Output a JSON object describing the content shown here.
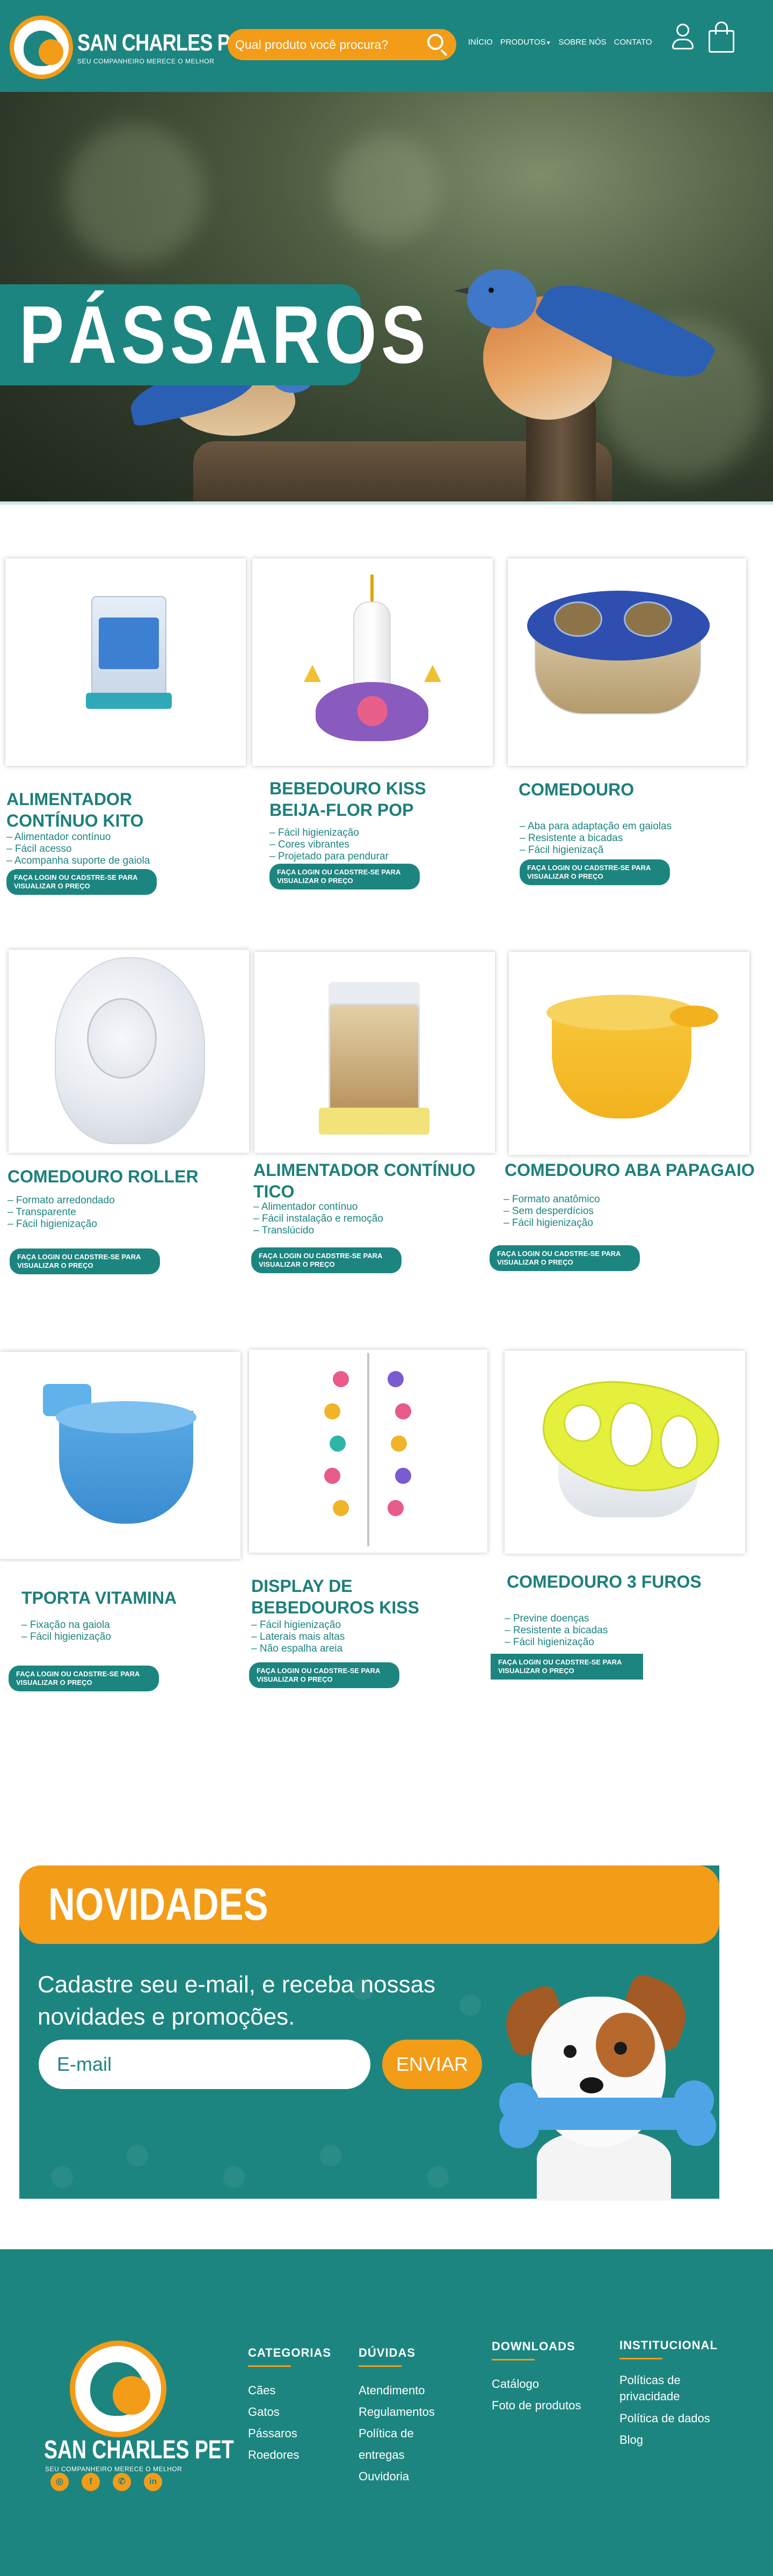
{
  "header": {
    "logo_name": "SAN CHARLES PET",
    "logo_tagline": "SEU COMPANHEIRO MERECE O MELHOR",
    "search_placeholder": "Qual produto você procura?",
    "nav": [
      "INÍCIO",
      "PRODUTOS",
      "SOBRE NÓS",
      "CONTATO"
    ],
    "icons": [
      "search-icon",
      "user-icon",
      "bag-icon"
    ]
  },
  "hero": {
    "title": "PÁSSAROS"
  },
  "products": [
    {
      "name": "ALIMENTADOR CONTÍNUO KITO",
      "features": [
        "Alimentador contínuo",
        "Fácil acesso",
        "Acompanha suporte de gaiola"
      ],
      "cta": "FAÇA LOGIN OU CADSTRE-SE PARA VISUALIZAR O PREÇO"
    },
    {
      "name": "BEBEDOURO KISS BEIJA-FLOR POP",
      "features": [
        "Fácil higienização",
        "Cores vibrantes",
        "Projetado para pendurar"
      ],
      "cta": "FAÇA LOGIN OU CADSTRE-SE PARA VISUALIZAR O PREÇO"
    },
    {
      "name": "COMEDOURO",
      "features": [
        "Aba para adaptação em gaiolas",
        "Resistente a bicadas",
        "Fácil higienizaçã"
      ],
      "cta": "FAÇA LOGIN OU CADSTRE-SE PARA VISUALIZAR O PREÇO"
    },
    {
      "name": "COMEDOURO ROLLER",
      "features": [
        "Formato arredondado",
        "Transparente",
        "Fácil higienização"
      ],
      "cta": "FAÇA LOGIN OU CADSTRE-SE PARA VISUALIZAR O PREÇO"
    },
    {
      "name": "ALIMENTADOR CONTÍNUO TICO",
      "features": [
        "Alimentador contínuo",
        "Fácil instalação e remoção",
        "Translúcido"
      ],
      "cta": "FAÇA LOGIN OU CADSTRE-SE PARA VISUALIZAR O PREÇO"
    },
    {
      "name": "COMEDOURO ABA PAPAGAIO",
      "features": [
        "Formato anatômico",
        "Sem desperdícios",
        "Fácil higienização"
      ],
      "cta": "FAÇA LOGIN OU CADSTRE-SE PARA VISUALIZAR O PREÇO"
    },
    {
      "name": "TPORTA VITAMINA",
      "features": [
        "Fixação na gaiola",
        "Fácil higienização"
      ],
      "cta": "FAÇA LOGIN OU CADSTRE-SE PARA VISUALIZAR O PREÇO"
    },
    {
      "name": "DISPLAY DE BEBEDOUROS KISS",
      "features": [
        "Fácil higienização",
        "Laterais mais altas",
        "Não espalha areia"
      ],
      "cta": "FAÇA LOGIN OU CADSTRE-SE PARA VISUALIZAR O PREÇO"
    },
    {
      "name": "COMEDOURO 3 FUROS",
      "features": [
        "Previne doenças",
        "Resistente a bicadas",
        "Fácil higienização"
      ],
      "cta": "FAÇA LOGIN OU CADSTRE-SE PARA VISUALIZAR O PREÇO"
    }
  ],
  "newsletter": {
    "title": "NOVIDADES",
    "text": "Cadastre seu e-mail, e receba nossas novidades e promoções.",
    "email_placeholder": "E-mail",
    "button": "ENVIAR"
  },
  "footer": {
    "logo_name": "SAN CHARLES PET",
    "logo_tagline": "SEU COMPANHEIRO MERECE O MELHOR",
    "social": [
      "instagram-icon",
      "facebook-icon",
      "whatsapp-icon",
      "linkedin-icon"
    ],
    "categorias": {
      "title": "CATEGORIAS",
      "links": [
        "Cães",
        "Gatos",
        "Pássaros",
        "Roedores"
      ]
    },
    "duvidas": {
      "title": "DÚVIDAS",
      "links": [
        "Atendimento",
        "Regulamentos",
        "Política de entregas",
        "Ouvidoria"
      ]
    },
    "downloads": {
      "title": "DOWNLOADS",
      "links": [
        "Catálogo",
        "Foto de produtos"
      ]
    },
    "institucional": {
      "title": "INSTITUCIONAL",
      "links": [
        "Políticas de privacidade",
        "Política de dados",
        "Blog"
      ]
    }
  },
  "colors": {
    "teal": "#1d8580",
    "orange": "#f39c18",
    "white": "#ffffff"
  }
}
